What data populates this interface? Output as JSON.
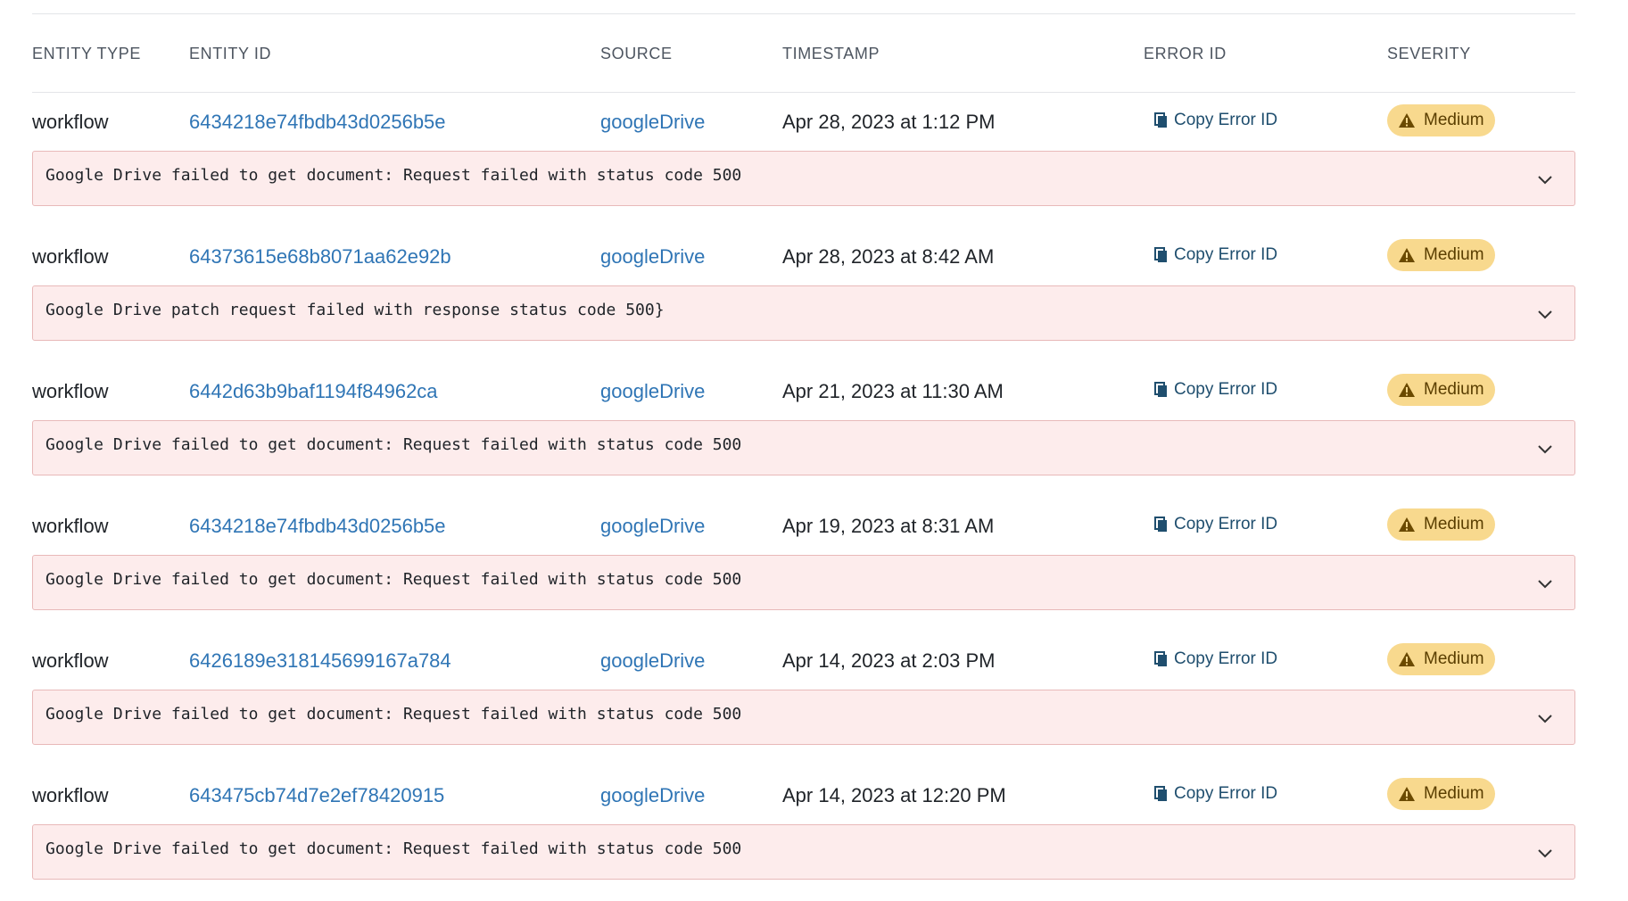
{
  "columns": {
    "entity_type": "ENTITY TYPE",
    "entity_id": "ENTITY ID",
    "source": "SOURCE",
    "timestamp": "TIMESTAMP",
    "error_id": "ERROR ID",
    "severity": "SEVERITY"
  },
  "copy_label": "Copy Error ID",
  "severity_color": "#f8d98e",
  "error_box_color": "#fdecec",
  "link_color": "#2f75b5",
  "rows": [
    {
      "entity_type": "workflow",
      "entity_id": "6434218e74fbdb43d0256b5e",
      "source": "googleDrive",
      "timestamp": "Apr 28, 2023 at 1:12 PM",
      "severity": "Medium",
      "message": "Google Drive failed to get document: Request failed with status code 500"
    },
    {
      "entity_type": "workflow",
      "entity_id": "64373615e68b8071aa62e92b",
      "source": "googleDrive",
      "timestamp": "Apr 28, 2023 at 8:42 AM",
      "severity": "Medium",
      "message": "Google Drive patch request failed with response status code 500}"
    },
    {
      "entity_type": "workflow",
      "entity_id": "6442d63b9baf1194f84962ca",
      "source": "googleDrive",
      "timestamp": "Apr 21, 2023 at 11:30 AM",
      "severity": "Medium",
      "message": "Google Drive failed to get document: Request failed with status code 500"
    },
    {
      "entity_type": "workflow",
      "entity_id": "6434218e74fbdb43d0256b5e",
      "source": "googleDrive",
      "timestamp": "Apr 19, 2023 at 8:31 AM",
      "severity": "Medium",
      "message": "Google Drive failed to get document: Request failed with status code 500"
    },
    {
      "entity_type": "workflow",
      "entity_id": "6426189e318145699167a784",
      "source": "googleDrive",
      "timestamp": "Apr 14, 2023 at 2:03 PM",
      "severity": "Medium",
      "message": "Google Drive failed to get document: Request failed with status code 500"
    },
    {
      "entity_type": "workflow",
      "entity_id": "643475cb74d7e2ef78420915",
      "source": "googleDrive",
      "timestamp": "Apr 14, 2023 at 12:20 PM",
      "severity": "Medium",
      "message": "Google Drive failed to get document: Request failed with status code 500"
    }
  ]
}
